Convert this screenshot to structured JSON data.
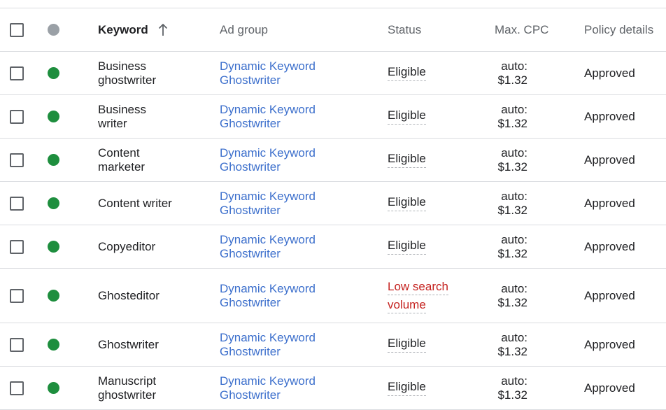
{
  "header": {
    "keyword": "Keyword",
    "ad_group": "Ad group",
    "status": "Status",
    "max_cpc": "Max. CPC",
    "policy_details": "Policy details"
  },
  "rows": [
    {
      "keyword_l1": "Business",
      "keyword_l2": "ghostwriter",
      "ad_group_l1": "Dynamic Keyword",
      "ad_group_l2": "Ghostwriter",
      "status": "Eligible",
      "cpc_l1": "auto:",
      "cpc_l2": "$1.32",
      "policy": "Approved"
    },
    {
      "keyword_l1": "Business",
      "keyword_l2": "writer",
      "ad_group_l1": "Dynamic Keyword",
      "ad_group_l2": "Ghostwriter",
      "status": "Eligible",
      "cpc_l1": "auto:",
      "cpc_l2": "$1.32",
      "policy": "Approved"
    },
    {
      "keyword_l1": "Content",
      "keyword_l2": "marketer",
      "ad_group_l1": "Dynamic Keyword",
      "ad_group_l2": "Ghostwriter",
      "status": "Eligible",
      "cpc_l1": "auto:",
      "cpc_l2": "$1.32",
      "policy": "Approved"
    },
    {
      "keyword_l1": "Content writer",
      "keyword_l2": "",
      "ad_group_l1": "Dynamic Keyword",
      "ad_group_l2": "Ghostwriter",
      "status": "Eligible",
      "cpc_l1": "auto:",
      "cpc_l2": "$1.32",
      "policy": "Approved"
    },
    {
      "keyword_l1": "Copyeditor",
      "keyword_l2": "",
      "ad_group_l1": "Dynamic Keyword",
      "ad_group_l2": "Ghostwriter",
      "status": "Eligible",
      "cpc_l1": "auto:",
      "cpc_l2": "$1.32",
      "policy": "Approved"
    },
    {
      "keyword_l1": "Ghosteditor",
      "keyword_l2": "",
      "ad_group_l1": "Dynamic Keyword",
      "ad_group_l2": "Ghostwriter",
      "status_l1": "Low search",
      "status_l2": "volume",
      "cpc_l1": "auto:",
      "cpc_l2": "$1.32",
      "policy": "Approved"
    },
    {
      "keyword_l1": "Ghostwriter",
      "keyword_l2": "",
      "ad_group_l1": "Dynamic Keyword",
      "ad_group_l2": "Ghostwriter",
      "status": "Eligible",
      "cpc_l1": "auto:",
      "cpc_l2": "$1.32",
      "policy": "Approved"
    },
    {
      "keyword_l1": "Manuscript",
      "keyword_l2": "ghostwriter",
      "ad_group_l1": "Dynamic Keyword",
      "ad_group_l2": "Ghostwriter",
      "status": "Eligible",
      "cpc_l1": "auto:",
      "cpc_l2": "$1.32",
      "policy": "Approved"
    }
  ],
  "colors": {
    "status_eligible_dot": "#1e8e3e",
    "header_status_dot": "#9aa0a6",
    "link": "#3c6fcc",
    "warning_text": "#c5221f"
  },
  "icons": {
    "sort": "arrow-up-icon"
  }
}
